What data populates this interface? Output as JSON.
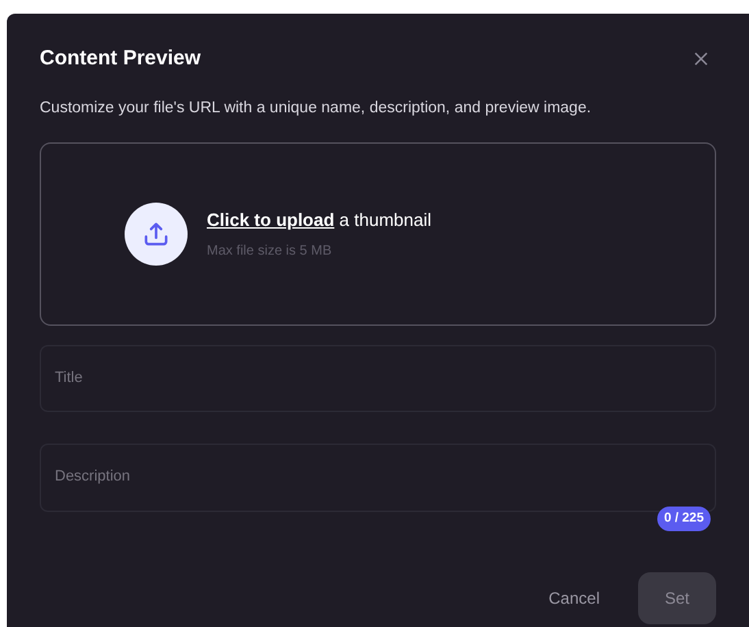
{
  "dialog": {
    "title": "Content Preview",
    "subtitle": "Customize your file's URL with a unique name, description, and preview image."
  },
  "upload": {
    "link": "Click to upload",
    "text": " a thumbnail",
    "hint": "Max file size is 5 MB"
  },
  "fields": [
    {
      "kind": "input",
      "placeholder": "Title"
    },
    {
      "kind": "textarea",
      "placeholder": "Description",
      "counter": "0 / 225"
    }
  ],
  "buttons": [
    {
      "label": "Cancel",
      "kind": "text",
      "disabled": false
    },
    {
      "label": "Set",
      "kind": "filled",
      "disabled": true
    }
  ]
}
